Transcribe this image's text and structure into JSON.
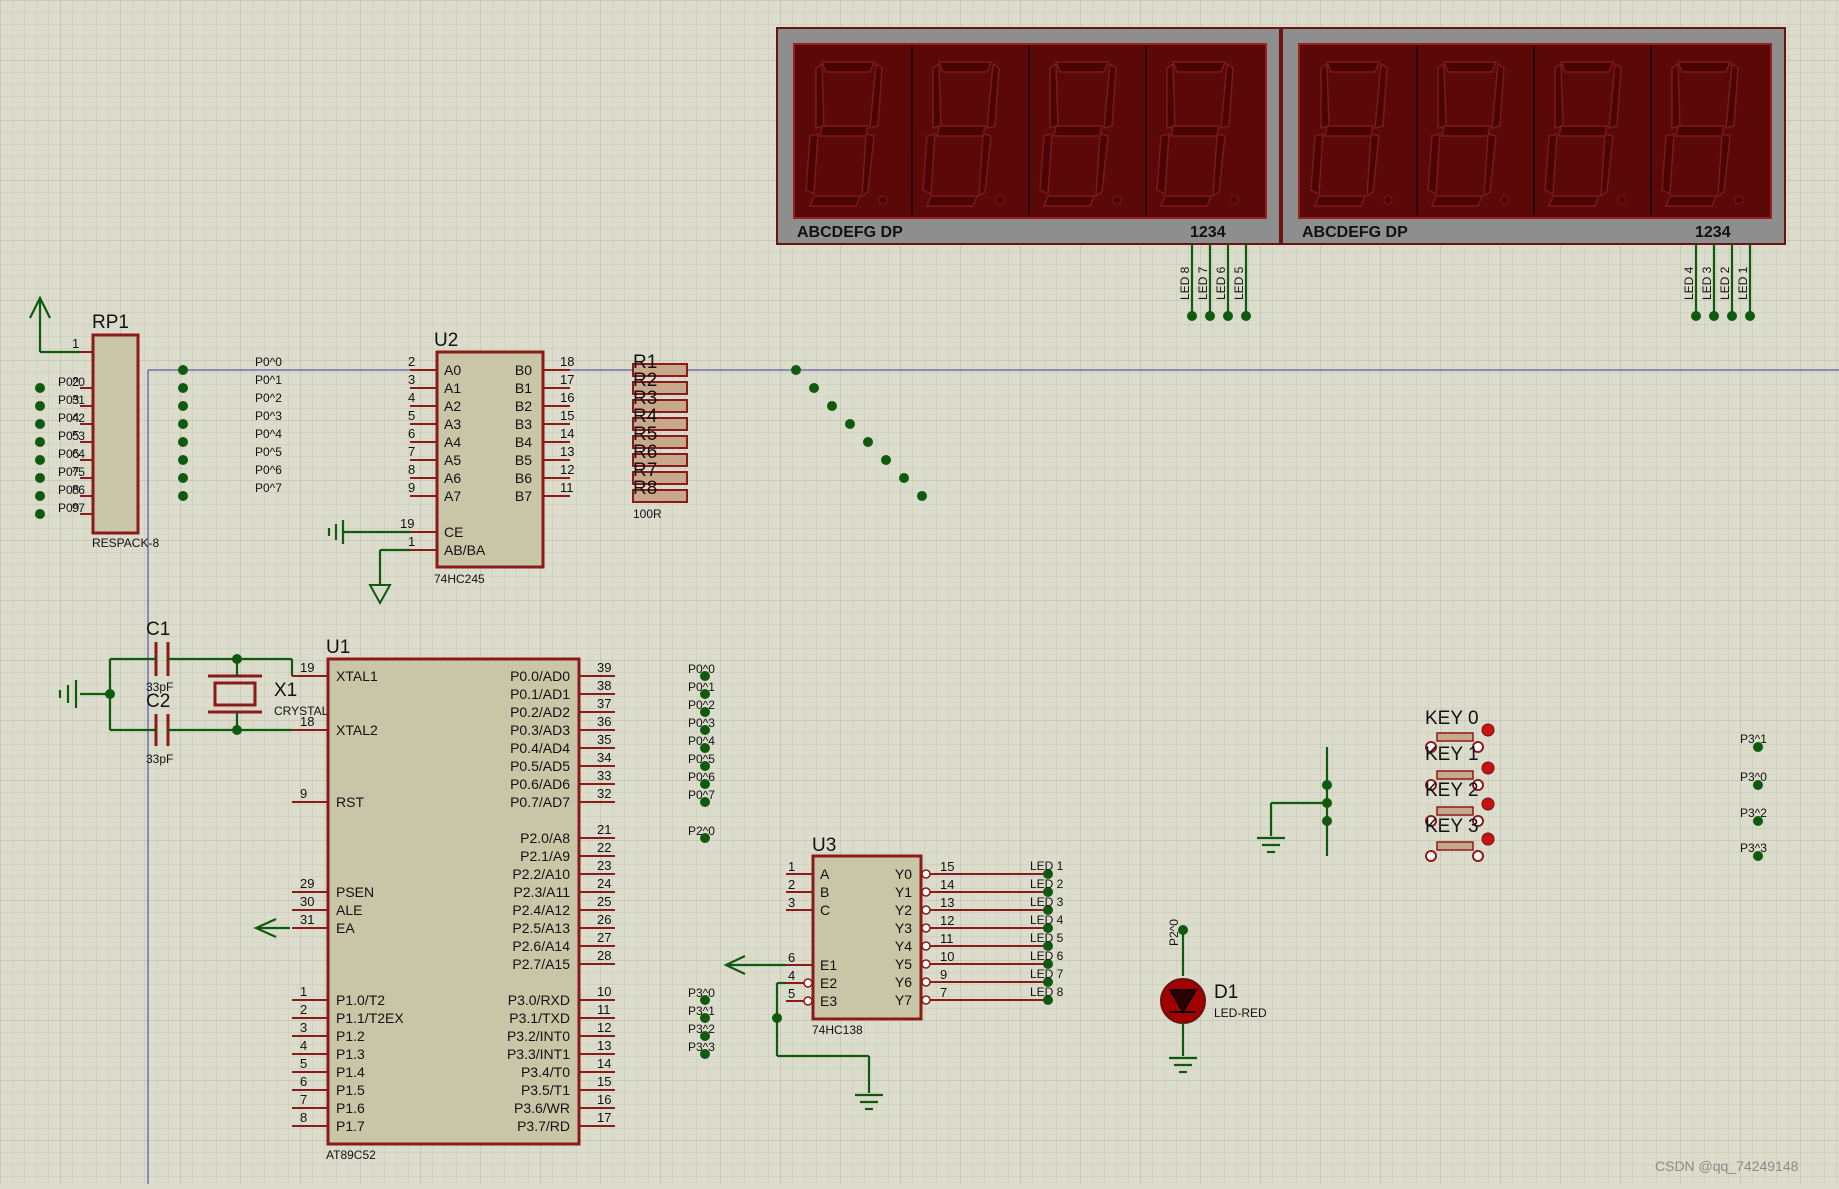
{
  "watermark": "CSDN @qq_74249148",
  "rp1": {
    "ref": "RP1",
    "value": "RESPACK-8",
    "pins": [
      "1",
      "2",
      "3",
      "4",
      "5",
      "6",
      "7",
      "8",
      "9"
    ],
    "nets": [
      "P0^0",
      "P0^1",
      "P0^2",
      "P0^3",
      "P0^4",
      "P0^5",
      "P0^6",
      "P0^7"
    ]
  },
  "u2": {
    "ref": "U2",
    "part": "74HC245",
    "left_pins": [
      {
        "num": "2",
        "name": "A0"
      },
      {
        "num": "3",
        "name": "A1"
      },
      {
        "num": "4",
        "name": "A2"
      },
      {
        "num": "5",
        "name": "A3"
      },
      {
        "num": "6",
        "name": "A4"
      },
      {
        "num": "7",
        "name": "A5"
      },
      {
        "num": "8",
        "name": "A6"
      },
      {
        "num": "9",
        "name": "A7"
      },
      {
        "num": "19",
        "name": "CE"
      },
      {
        "num": "1",
        "name": "AB/BA"
      }
    ],
    "right_pins": [
      {
        "num": "18",
        "name": "B0"
      },
      {
        "num": "17",
        "name": "B1"
      },
      {
        "num": "16",
        "name": "B2"
      },
      {
        "num": "15",
        "name": "B3"
      },
      {
        "num": "14",
        "name": "B4"
      },
      {
        "num": "13",
        "name": "B5"
      },
      {
        "num": "12",
        "name": "B6"
      },
      {
        "num": "11",
        "name": "B7"
      }
    ],
    "in_nets": [
      "P0^0",
      "P0^1",
      "P0^2",
      "P0^3",
      "P0^4",
      "P0^5",
      "P0^6",
      "P0^7"
    ]
  },
  "resistors": {
    "refs": [
      "R1",
      "R2",
      "R3",
      "R4",
      "R5",
      "R6",
      "R7",
      "R8"
    ],
    "value": "100R"
  },
  "display": {
    "bottom_left": "ABCDEFG  DP",
    "bottom_right": "1234",
    "left_leds": [
      "LED 8",
      "LED 7",
      "LED 6",
      "LED 5"
    ],
    "right_leds": [
      "LED 4",
      "LED 3",
      "LED 2",
      "LED 1"
    ]
  },
  "c1": {
    "ref": "C1",
    "value": "33pF"
  },
  "c2": {
    "ref": "C2",
    "value": "33pF"
  },
  "x1": {
    "ref": "X1",
    "value": "CRYSTAL"
  },
  "u1": {
    "ref": "U1",
    "part": "AT89C52",
    "left_pins": [
      {
        "num": "19",
        "name": "XTAL1"
      },
      {
        "num": "18",
        "name": "XTAL2"
      },
      {
        "num": "9",
        "name": "RST"
      },
      {
        "num": "29",
        "name": "PSEN"
      },
      {
        "num": "30",
        "name": "ALE"
      },
      {
        "num": "31",
        "name": "EA"
      },
      {
        "num": "1",
        "name": "P1.0/T2"
      },
      {
        "num": "2",
        "name": "P1.1/T2EX"
      },
      {
        "num": "3",
        "name": "P1.2"
      },
      {
        "num": "4",
        "name": "P1.3"
      },
      {
        "num": "5",
        "name": "P1.4"
      },
      {
        "num": "6",
        "name": "P1.5"
      },
      {
        "num": "7",
        "name": "P1.6"
      },
      {
        "num": "8",
        "name": "P1.7"
      }
    ],
    "right_pins": [
      {
        "num": "39",
        "name": "P0.0/AD0"
      },
      {
        "num": "38",
        "name": "P0.1/AD1"
      },
      {
        "num": "37",
        "name": "P0.2/AD2"
      },
      {
        "num": "36",
        "name": "P0.3/AD3"
      },
      {
        "num": "35",
        "name": "P0.4/AD4"
      },
      {
        "num": "34",
        "name": "P0.5/AD5"
      },
      {
        "num": "33",
        "name": "P0.6/AD6"
      },
      {
        "num": "32",
        "name": "P0.7/AD7"
      },
      {
        "num": "21",
        "name": "P2.0/A8"
      },
      {
        "num": "22",
        "name": "P2.1/A9"
      },
      {
        "num": "23",
        "name": "P2.2/A10"
      },
      {
        "num": "24",
        "name": "P2.3/A11"
      },
      {
        "num": "25",
        "name": "P2.4/A12"
      },
      {
        "num": "26",
        "name": "P2.5/A13"
      },
      {
        "num": "27",
        "name": "P2.6/A14"
      },
      {
        "num": "28",
        "name": "P2.7/A15"
      },
      {
        "num": "10",
        "name": "P3.0/RXD"
      },
      {
        "num": "11",
        "name": "P3.1/TXD"
      },
      {
        "num": "12",
        "name": "P3.2/INT0"
      },
      {
        "num": "13",
        "name": "P3.3/INT1"
      },
      {
        "num": "14",
        "name": "P3.4/T0"
      },
      {
        "num": "15",
        "name": "P3.5/T1"
      },
      {
        "num": "16",
        "name": "P3.6/WR"
      },
      {
        "num": "17",
        "name": "P3.7/RD"
      }
    ],
    "p0_nets": [
      "P0^0",
      "P0^1",
      "P0^2",
      "P0^3",
      "P0^4",
      "P0^5",
      "P0^6",
      "P0^7"
    ],
    "p2_net": "P2^0",
    "p3_nets": [
      "P3^0",
      "P3^1",
      "P3^2",
      "P3^3"
    ]
  },
  "u3": {
    "ref": "U3",
    "part": "74HC138",
    "left_pins": [
      {
        "num": "1",
        "name": "A"
      },
      {
        "num": "2",
        "name": "B"
      },
      {
        "num": "3",
        "name": "C"
      },
      {
        "num": "6",
        "name": "E1"
      },
      {
        "num": "4",
        "name": "E2"
      },
      {
        "num": "5",
        "name": "E3"
      }
    ],
    "right_pins": [
      {
        "num": "15",
        "name": "Y0"
      },
      {
        "num": "14",
        "name": "Y1"
      },
      {
        "num": "13",
        "name": "Y2"
      },
      {
        "num": "12",
        "name": "Y3"
      },
      {
        "num": "11",
        "name": "Y4"
      },
      {
        "num": "10",
        "name": "Y5"
      },
      {
        "num": "9",
        "name": "Y6"
      },
      {
        "num": "7",
        "name": "Y7"
      }
    ],
    "out_nets": [
      "LED 1",
      "LED 2",
      "LED 3",
      "LED 4",
      "LED 5",
      "LED 6",
      "LED 7",
      "LED 8"
    ]
  },
  "keys": {
    "refs": [
      "KEY 0",
      "KEY 1",
      "KEY 2",
      "KEY 3"
    ],
    "nets": [
      "P3^1",
      "P3^0",
      "P3^2",
      "P3^3"
    ]
  },
  "d1": {
    "ref": "D1",
    "value": "LED-RED",
    "net": "P2^0"
  }
}
